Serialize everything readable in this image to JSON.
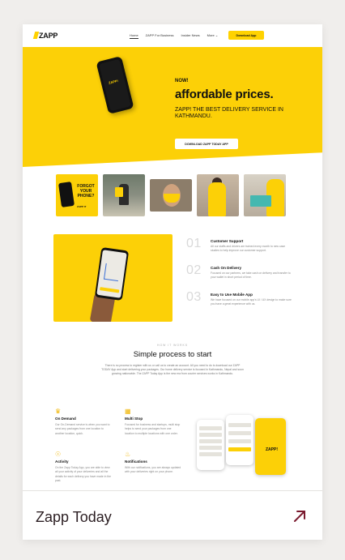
{
  "nav": {
    "logo": "ZAPP",
    "links": [
      "Home",
      "ZAPP For Business",
      "Insider News",
      "More"
    ],
    "more_chevron": "chevron-down-icon",
    "cta": "Download App"
  },
  "hero": {
    "phone_logo": "ZAPP!",
    "now": "NOW!",
    "headline": "affordable prices.",
    "sub": "ZAPP! THE BEST DELIVERY SERVICE IN KATHMANDU.",
    "button": "DOWNLOAD ZAPP TODAY APP"
  },
  "gallery": {
    "promo_title": "FORGOT YOUR PHONE?",
    "promo_small": "ZAPP IT"
  },
  "features": [
    {
      "num": "01",
      "title": "Customer Support",
      "desc": "All our staffs and drivers are trained every month to new case studies to help improve our customer support."
    },
    {
      "num": "02",
      "title": "Cash On Delivery",
      "desc": "Focused on our partners, we take cash on delivery and transfer to your wallet in short period of time."
    },
    {
      "num": "03",
      "title": "Easy to Use Mobile App",
      "desc": "We have focused on our mobile app's UI / UX design to make sure you have a great experience with us."
    }
  ],
  "how": {
    "kicker": "HOW IT WORKS",
    "title": "Simple process to start",
    "text": "There is no process to register with us or call us to create an account. All you need to do is download our ZAPP TODAY App and start delivering your packages. Our home delivery service is focused in Kathmandu, Nepal and soon growing nationwide. The ZAPP Today App is the new era from courier services works in Kathmandu."
  },
  "services": [
    {
      "icon": "scooter-icon",
      "title": "On Demand",
      "desc": "Our On-Demand service is when you want to send any packages from one location to another location, quick."
    },
    {
      "icon": "boxes-icon",
      "title": "Multi Stop",
      "desc": "Focused for business and startups, multi stop helps to send your packages from one location to multiple locations with one order."
    },
    {
      "icon": "activity-icon",
      "title": "Activity",
      "desc": "On the Zapp Today App, you are able to view all your activity of your deliveries and all the details for each delivery you have made in the past."
    },
    {
      "icon": "bell-icon",
      "title": "Notifications",
      "desc": "With our notifications, you are always updated with your deliveries right on your phone."
    }
  ],
  "stack_logo": "ZAPP!",
  "caption": {
    "title": "Zapp Today",
    "arrow": "arrow-up-right-icon"
  },
  "colors": {
    "brand_yellow": "#fcd007",
    "caption_text": "#2b1e22",
    "arrow": "#7a1a2e"
  }
}
